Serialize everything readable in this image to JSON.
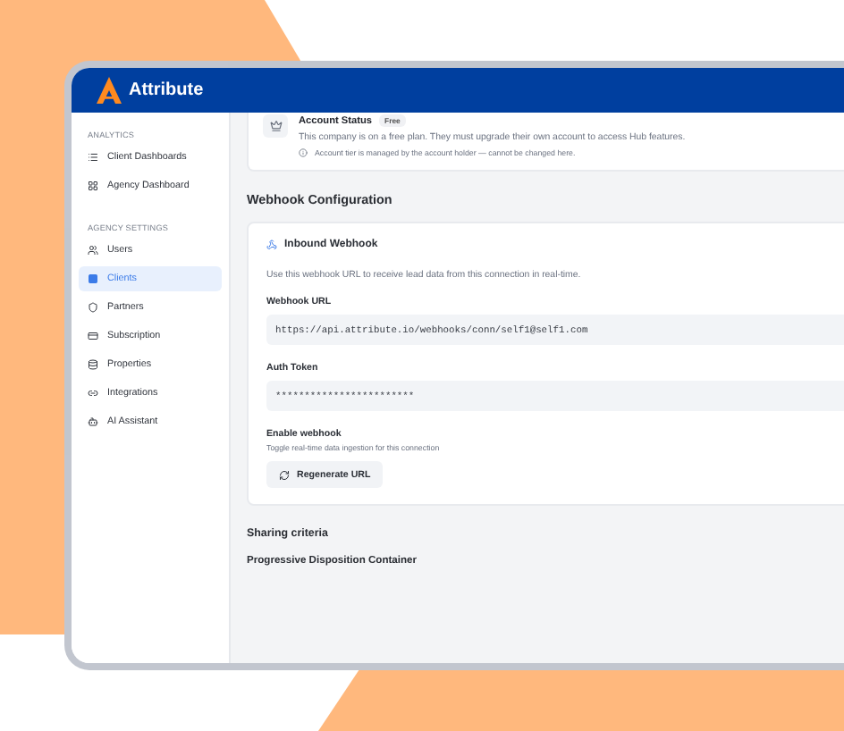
{
  "app": {
    "name": "Attribute"
  },
  "sidebar": {
    "sections": [
      {
        "heading": "ANALYTICS",
        "items": [
          {
            "label": "Client Dashboards",
            "selected": false
          },
          {
            "label": "Agency Dashboard",
            "selected": false
          }
        ]
      },
      {
        "heading": "AGENCY SETTINGS",
        "items": [
          {
            "label": "Users",
            "selected": false
          },
          {
            "label": "Clients",
            "selected": true
          },
          {
            "label": "Partners",
            "selected": false
          },
          {
            "label": "Subscription",
            "selected": false
          },
          {
            "label": "Properties",
            "selected": false
          },
          {
            "label": "Integrations",
            "selected": false
          },
          {
            "label": "AI Assistant",
            "selected": false
          }
        ]
      }
    ]
  },
  "account_status": {
    "title": "Account Status",
    "badge": "Free",
    "description": "This company is on a free plan. They must upgrade their own account to access Hub features.",
    "note": "Account tier is managed by the account holder — cannot be changed here."
  },
  "webhook_configuration": {
    "heading": "Webhook Configuration",
    "card": {
      "title": "Inbound Webhook",
      "description": "Use this webhook URL to receive lead data from this connection in real-time.",
      "fields": [
        {
          "label": "Webhook URL",
          "value": "https://api.attribute.io/webhooks/conn/self1@self1.com"
        },
        {
          "label": "Auth Token",
          "value": "************************"
        }
      ],
      "toggle": {
        "label": "Enable webhook",
        "description": "Toggle real-time data ingestion for this connection"
      },
      "button": "Regenerate URL"
    }
  },
  "sharing_criteria": {
    "heading": "Sharing criteria",
    "subheading": "Progressive Disposition Container"
  }
}
